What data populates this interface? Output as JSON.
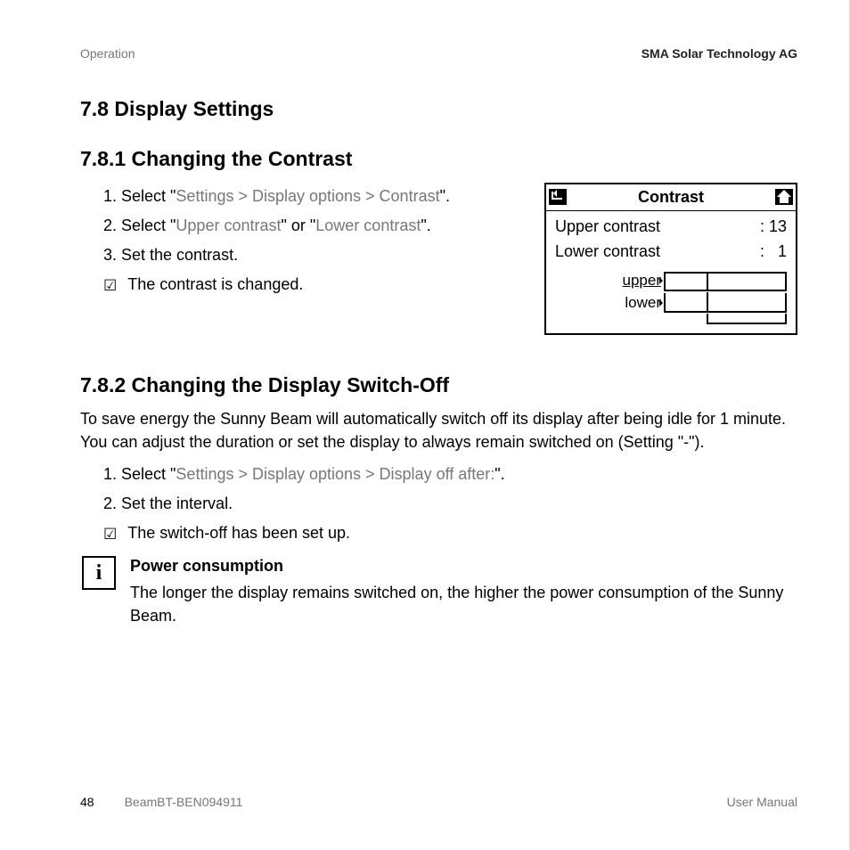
{
  "header": {
    "left": "Operation",
    "right": "SMA Solar Technology AG"
  },
  "section": {
    "title": "7.8  Display Settings"
  },
  "s781": {
    "title": "7.8.1  Changing the Contrast",
    "steps": [
      {
        "prefix": "Select \"",
        "mid": "Settings > Display options > Contrast",
        "suffix": "\"."
      },
      {
        "prefix": "Select \"",
        "mid": "Upper contrast",
        "suffix": "\" or \"",
        "mid2": "Lower contrast",
        "tail": "\"."
      },
      {
        "plain": "Set the contrast."
      }
    ],
    "result": "The contrast is changed."
  },
  "lcd": {
    "title": "Contrast",
    "rows": [
      {
        "label": "Upper contrast",
        "value": ": 13"
      },
      {
        "label": "Lower contrast",
        "value": ":   1"
      }
    ],
    "upper_label": "upper",
    "lower_label": "lower"
  },
  "s782": {
    "title": "7.8.2  Changing the Display Switch-Off",
    "intro": "To save energy the Sunny Beam will automatically switch off its display after being idle for 1 minute. You can adjust the duration or set the display to always remain switched on (Setting \"-\").",
    "steps": [
      {
        "prefix": "Select \"",
        "mid": "Settings > Display options > Display off after:",
        "suffix": "\"."
      },
      {
        "plain": "Set the interval."
      }
    ],
    "result": "The switch-off has been set up.",
    "info": {
      "title": "Power consumption",
      "body": "The longer the display remains switched on, the higher the power consumption of the Sunny Beam."
    }
  },
  "footer": {
    "page": "48",
    "doc": "BeamBT-BEN094911",
    "label": "User Manual"
  }
}
